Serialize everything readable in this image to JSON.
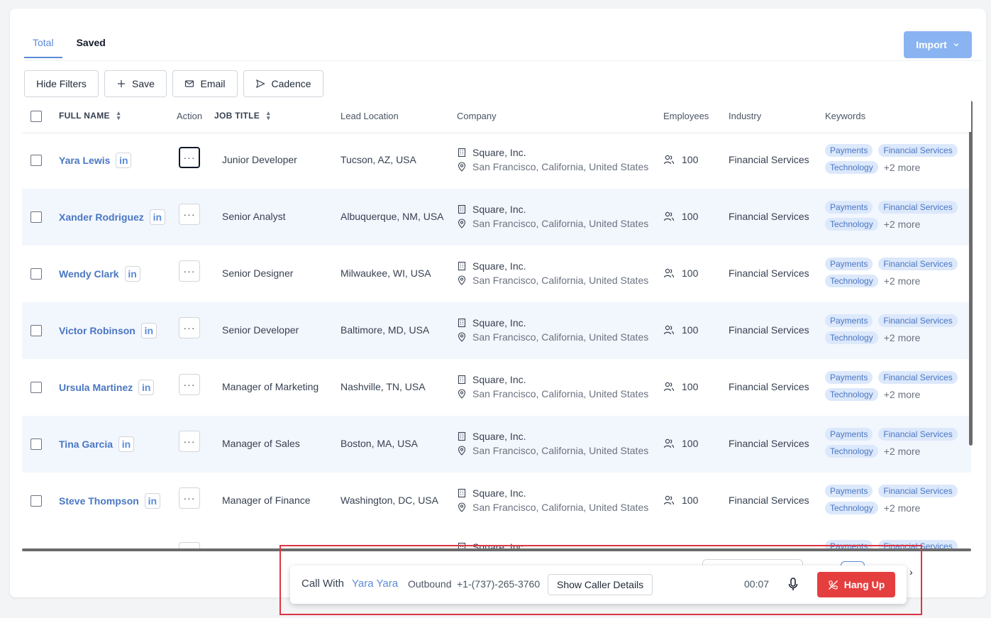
{
  "tabs": [
    {
      "label": "Total",
      "active": true
    },
    {
      "label": "Saved",
      "active": false
    }
  ],
  "import_label": "Import",
  "toolbar": {
    "hide_filters": "Hide Filters",
    "save": "Save",
    "email": "Email",
    "cadence": "Cadence"
  },
  "columns": {
    "full_name": "FULL NAME",
    "action": "Action",
    "job_title": "JOB TITLE",
    "lead_location": "Lead Location",
    "company": "Company",
    "employees": "Employees",
    "industry": "Industry",
    "keywords": "Keywords"
  },
  "rows": [
    {
      "name": "Yara Lewis",
      "job": "Junior Developer",
      "location": "Tucson, AZ, USA",
      "company": "Square, Inc.",
      "company_location": "San Francisco, California, United States",
      "employees": "100",
      "industry": "Financial Services",
      "keywords": [
        "Payments",
        "Financial Services",
        "Technology"
      ],
      "more": "+2 more"
    },
    {
      "name": "Xander Rodriguez",
      "job": "Senior Analyst",
      "location": "Albuquerque, NM, USA",
      "company": "Square, Inc.",
      "company_location": "San Francisco, California, United States",
      "employees": "100",
      "industry": "Financial Services",
      "keywords": [
        "Payments",
        "Financial Services",
        "Technology"
      ],
      "more": "+2 more"
    },
    {
      "name": "Wendy Clark",
      "job": "Senior Designer",
      "location": "Milwaukee, WI, USA",
      "company": "Square, Inc.",
      "company_location": "San Francisco, California, United States",
      "employees": "100",
      "industry": "Financial Services",
      "keywords": [
        "Payments",
        "Financial Services",
        "Technology"
      ],
      "more": "+2 more"
    },
    {
      "name": "Victor Robinson",
      "job": "Senior Developer",
      "location": "Baltimore, MD, USA",
      "company": "Square, Inc.",
      "company_location": "San Francisco, California, United States",
      "employees": "100",
      "industry": "Financial Services",
      "keywords": [
        "Payments",
        "Financial Services",
        "Technology"
      ],
      "more": "+2 more"
    },
    {
      "name": "Ursula Martinez",
      "job": "Manager of Marketing",
      "location": "Nashville, TN, USA",
      "company": "Square, Inc.",
      "company_location": "San Francisco, California, United States",
      "employees": "100",
      "industry": "Financial Services",
      "keywords": [
        "Payments",
        "Financial Services",
        "Technology"
      ],
      "more": "+2 more"
    },
    {
      "name": "Tina Garcia",
      "job": "Manager of Sales",
      "location": "Boston, MA, USA",
      "company": "Square, Inc.",
      "company_location": "San Francisco, California, United States",
      "employees": "100",
      "industry": "Financial Services",
      "keywords": [
        "Payments",
        "Financial Services",
        "Technology"
      ],
      "more": "+2 more"
    },
    {
      "name": "Steve Thompson",
      "job": "Manager of Finance",
      "location": "Washington, DC, USA",
      "company": "Square, Inc.",
      "company_location": "San Francisco, California, United States",
      "employees": "100",
      "industry": "Financial Services",
      "keywords": [
        "Payments",
        "Financial Services",
        "Technology"
      ],
      "more": "+2 more"
    }
  ],
  "partial_row": {
    "company": "Square, Inc.",
    "keywords": [
      "Payments",
      "Financial Services"
    ]
  },
  "linkedin_label": "in",
  "action_label": "···",
  "call": {
    "prefix": "Call With",
    "caller": "Yara Yara",
    "direction": "Outbound",
    "phone": "+1-(737)-265-3760",
    "details_button": "Show Caller Details",
    "timer": "00:07",
    "hangup": "Hang Up"
  },
  "pager_next": "›",
  "colors": {
    "accent": "#5b8bd8",
    "import": "#8ab4f1",
    "hangup": "#e53e3e",
    "highlight": "#dc3545",
    "row_alt": "#f2f6fd"
  }
}
